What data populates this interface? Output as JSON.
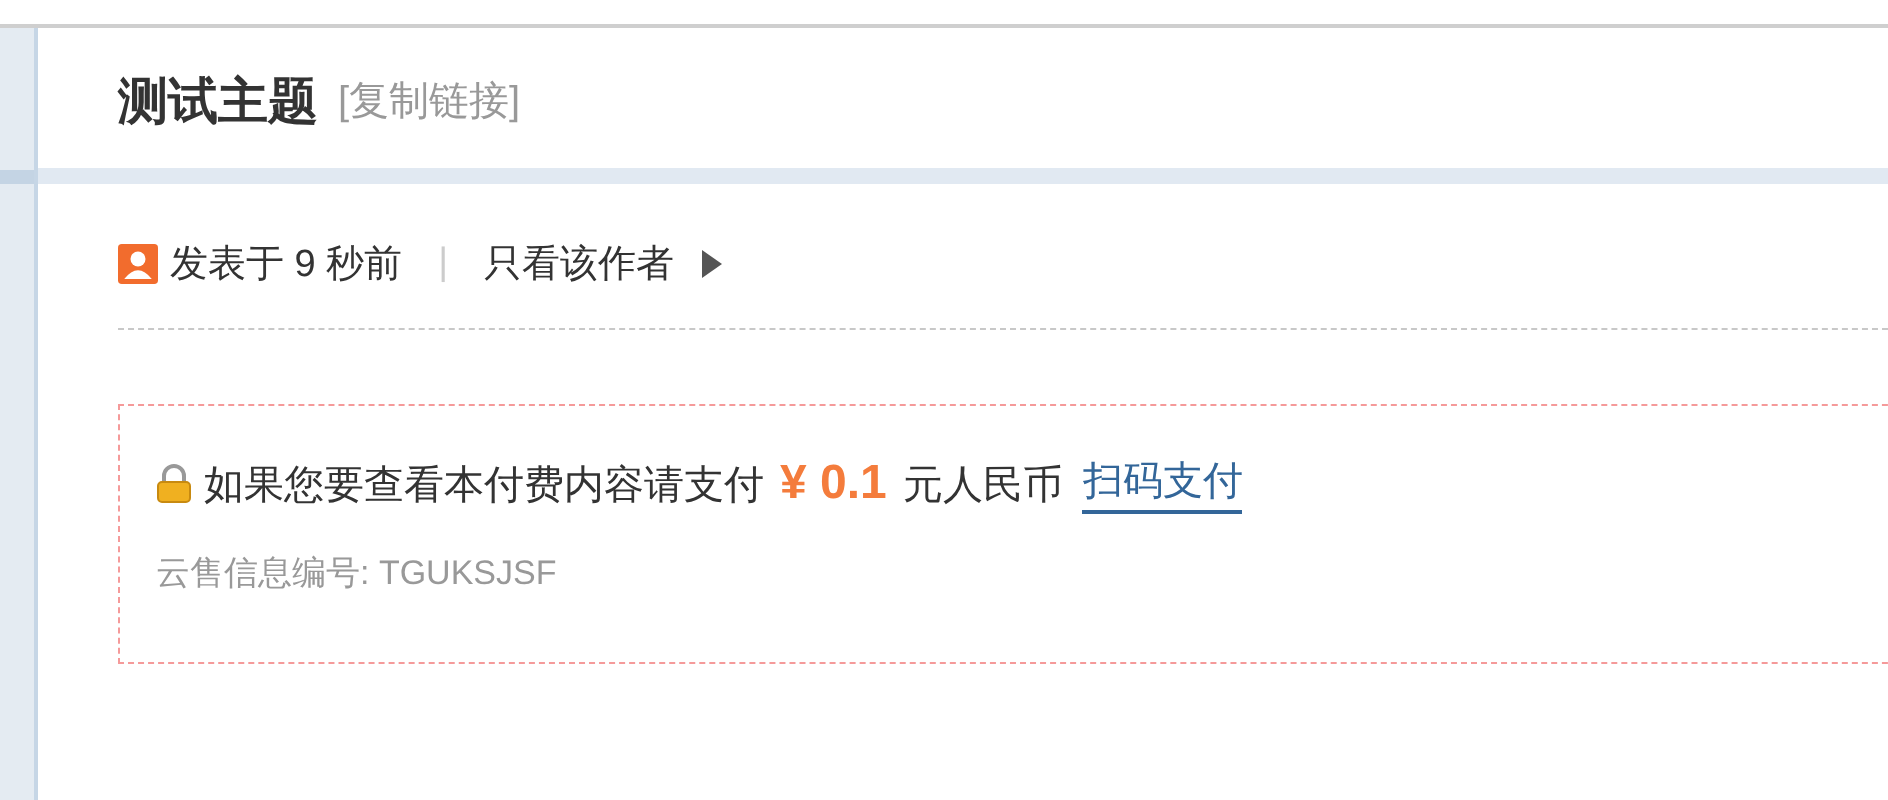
{
  "thread": {
    "title": "测试主题",
    "copy_link": "[复制链接]"
  },
  "post_meta": {
    "posted": "发表于 9 秒前",
    "separator": "|",
    "author_only": "只看该作者"
  },
  "paid_content": {
    "notice": "如果您要查看本付费内容请支付",
    "price": "¥ 0.1",
    "unit": "元人民币",
    "pay_link": "扫码支付",
    "info": "云售信息编号: TGUKSJSF"
  }
}
